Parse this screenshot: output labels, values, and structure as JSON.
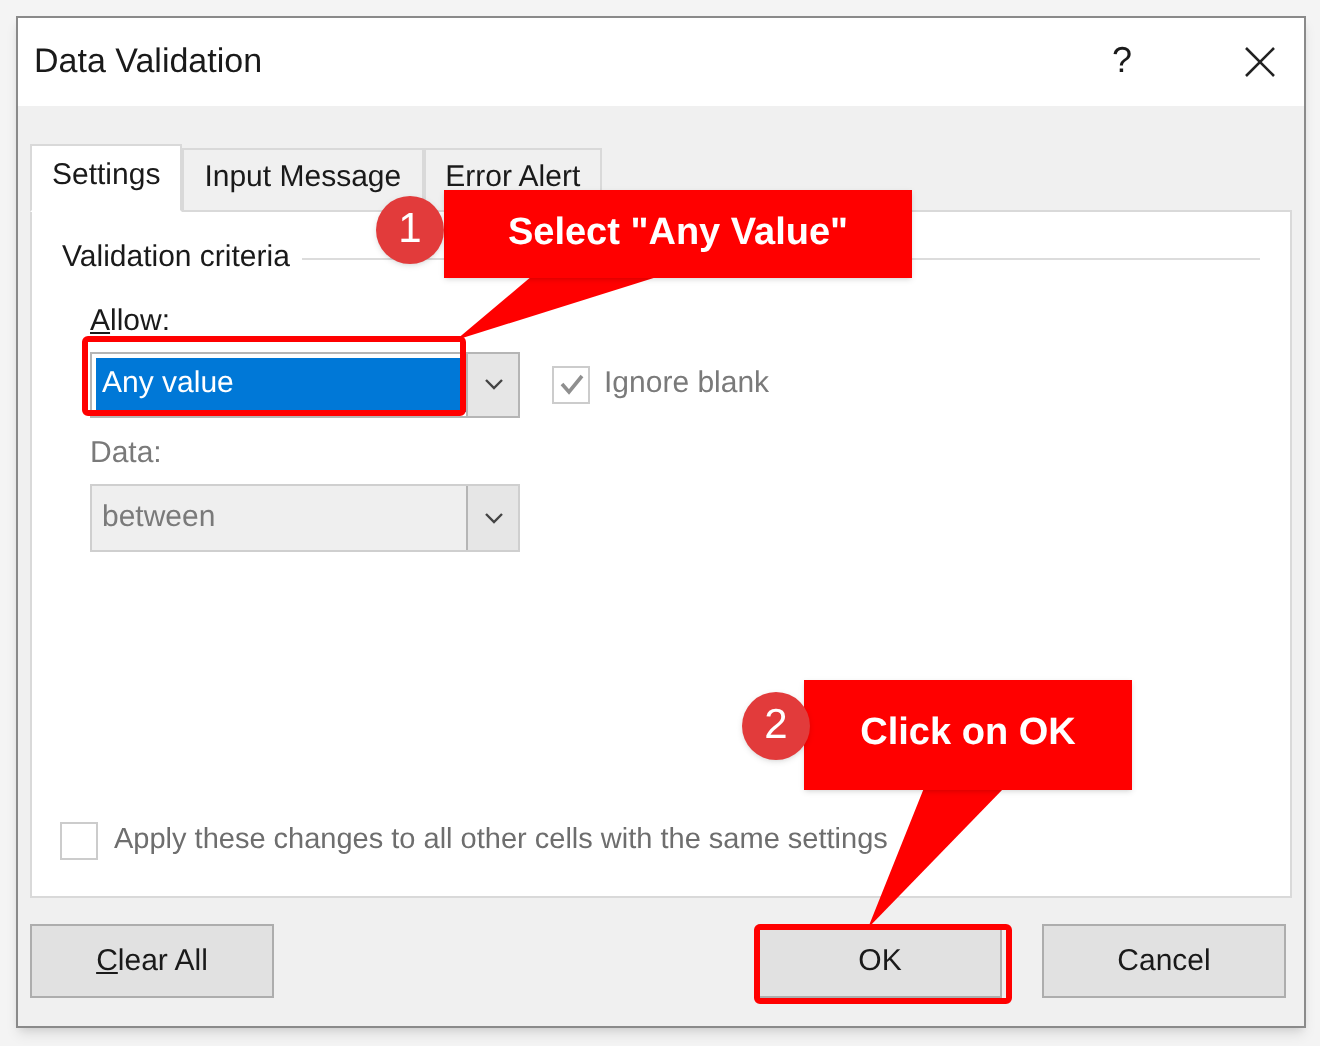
{
  "window": {
    "title": "Data Validation",
    "help": "?"
  },
  "tabs": [
    {
      "label": "Settings",
      "selected": true
    },
    {
      "label": "Input Message",
      "selected": false
    },
    {
      "label": "Error Alert",
      "selected": false
    }
  ],
  "criteria": {
    "title": "Validation criteria",
    "allow": {
      "label": "Allow:",
      "mnemonic": true,
      "value": "Any value",
      "focused": true
    },
    "ignore_blank": {
      "label": "Ignore blank",
      "checked": true,
      "disabled": true
    },
    "data": {
      "label": "Data:",
      "value": "between",
      "disabled": true
    }
  },
  "apply_all": {
    "label": "Apply these changes to all other cells with the same settings",
    "checked": false,
    "disabled": true
  },
  "buttons": [
    {
      "label": "Clear All",
      "mnemonic": true,
      "highlighted": false
    },
    {
      "label": "OK",
      "mnemonic": false,
      "highlighted": true
    },
    {
      "label": "Cancel",
      "mnemonic": false,
      "highlighted": false
    }
  ],
  "callouts": [
    {
      "badge": "1",
      "text": "Select \"Any Value\""
    },
    {
      "badge": "2",
      "text": "Click on OK"
    }
  ]
}
